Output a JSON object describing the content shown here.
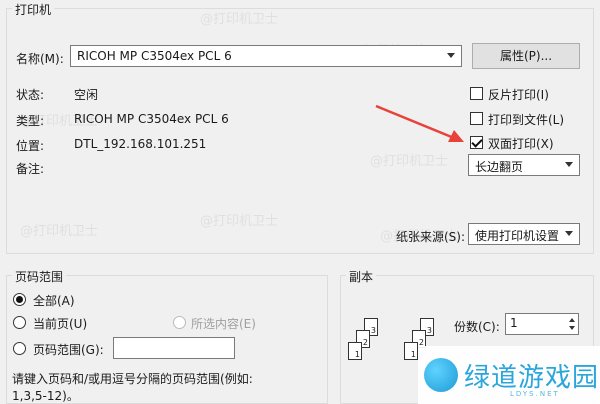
{
  "printer_group": {
    "title": "打印机",
    "name_label": "名称(M):",
    "name_value": "RICOH MP C3504ex PCL 6",
    "properties_button": "属性(P)...",
    "status_label": "状态:",
    "status_value": "空闲",
    "type_label": "类型:",
    "type_value": "RICOH MP C3504ex PCL 6",
    "location_label": "位置:",
    "location_value": "DTL_192.168.101.251",
    "comment_label": "备注:",
    "reverse_print": "反片打印(I)",
    "print_to_file": "打印到文件(L)",
    "duplex_print": "双面打印(X)",
    "duplex_mode": "长边翻页",
    "paper_source_label": "纸张来源(S):",
    "paper_source_value": "使用打印机设置"
  },
  "page_range_group": {
    "title": "页码范围",
    "all": "全部(A)",
    "current_page": "当前页(U)",
    "selection": "所选内容(E)",
    "pages": "页码范围(G):",
    "hint_line1": "请键入页码和/或用逗号分隔的页码范围(例如:",
    "hint_line2": "1,3,5-12)。"
  },
  "copies_group": {
    "title": "副本",
    "copies_label": "份数(C):",
    "copies_value": "1"
  },
  "watermark": "@打印机卫士",
  "brand": {
    "name": "绿道游戏园",
    "sub": "LDYS.NET"
  },
  "annotation": {
    "arrow_color": "#e8423a"
  }
}
